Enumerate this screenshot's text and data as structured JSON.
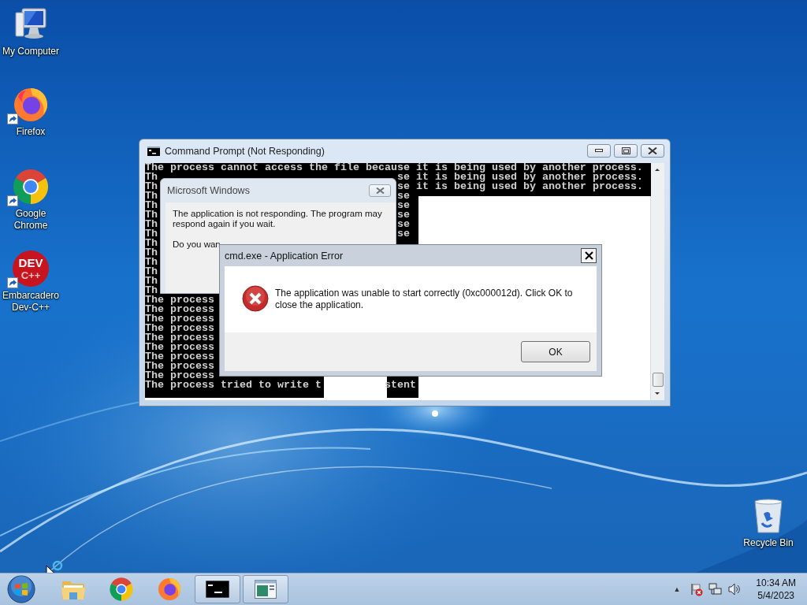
{
  "desktop_icons": [
    {
      "label": "My Computer",
      "kind": "computer",
      "shortcut": false
    },
    {
      "label": "Firefox",
      "kind": "firefox",
      "shortcut": true
    },
    {
      "label": "Google Chrome",
      "kind": "chrome",
      "shortcut": true
    },
    {
      "label": "Embarcadero Dev-C++",
      "kind": "devcpp",
      "shortcut": true,
      "logo_text": [
        "DEV",
        "C++"
      ]
    }
  ],
  "recycle_bin": {
    "label": "Recycle Bin"
  },
  "cmd_window": {
    "title": "Command Prompt (Not Responding)",
    "console": [
      {
        "left": "The process cannot access the file because it is being used by another process."
      },
      {
        "left": "Th",
        "right": "se it is being used by another process."
      },
      {
        "left": "Th",
        "right": "se it is being used by another process."
      },
      {
        "left": "Th",
        "right": "se"
      },
      {
        "left": "Th",
        "right": "se"
      },
      {
        "left": "Th",
        "right": "se"
      },
      {
        "left": "Th",
        "right": "se"
      },
      {
        "left": "Th",
        "right": "se"
      },
      {
        "left": "Th"
      },
      {
        "left": "Th"
      },
      {
        "left": "Th"
      },
      {
        "left": "Th"
      },
      {
        "left": "Th"
      },
      {
        "left": "Th"
      },
      {
        "left": "The process"
      },
      {
        "left": "The process"
      },
      {
        "left": "The process"
      },
      {
        "left": "The process"
      },
      {
        "left": "The process"
      },
      {
        "left": "The process"
      },
      {
        "left": "The process"
      },
      {
        "left": "The process"
      },
      {
        "left": "The process"
      },
      {
        "left": "The process tried to write t",
        "right": "stent"
      }
    ]
  },
  "not_responding_dialog": {
    "title": "Microsoft Windows",
    "message": "The application is not responding. The program may respond again if you wait.",
    "question": "Do you wan"
  },
  "error_dialog": {
    "title": "cmd.exe - Application Error",
    "message": "The application was unable to start correctly (0xc000012d). Click OK to close the application.",
    "button": "OK"
  },
  "taskbar": {
    "items": [
      {
        "kind": "explorer",
        "running": false
      },
      {
        "kind": "chrome",
        "running": false
      },
      {
        "kind": "firefox",
        "running": false
      },
      {
        "kind": "cmd",
        "running": true
      },
      {
        "kind": "app",
        "running": true
      }
    ],
    "tray_arrow": "▲",
    "clock": {
      "time": "10:34 AM",
      "date": "5/4/2023"
    }
  }
}
